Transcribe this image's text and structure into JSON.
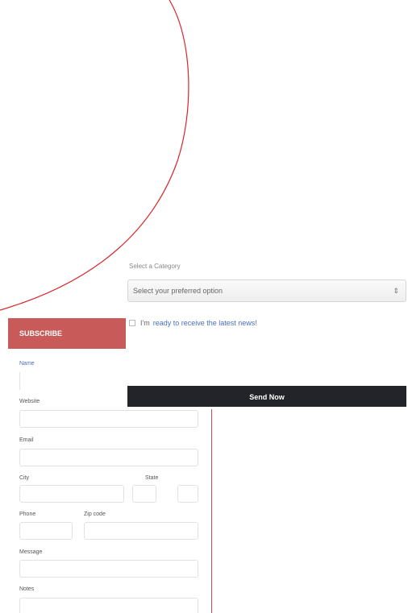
{
  "left_form": {
    "header_title": "SUBSCRIBE",
    "fields": {
      "name_label": "Name",
      "website_label": "Website",
      "email_label": "Email",
      "city_label": "City",
      "state_label": "State",
      "phone_label": "Phone",
      "zip_label": "Zip code",
      "message_label": "Message",
      "notes_label": "Notes"
    }
  },
  "right_form": {
    "select_label": "Select a Category",
    "select_value": "Select your preferred option",
    "checkbox_label_prefix": "I'm",
    "checkbox_label_text": "ready to receive the latest news!",
    "submit_label": "Send Now"
  },
  "colors": {
    "accent_red": "#c85a5a",
    "button_dark": "#22242a",
    "arc_red": "#d9262b"
  }
}
